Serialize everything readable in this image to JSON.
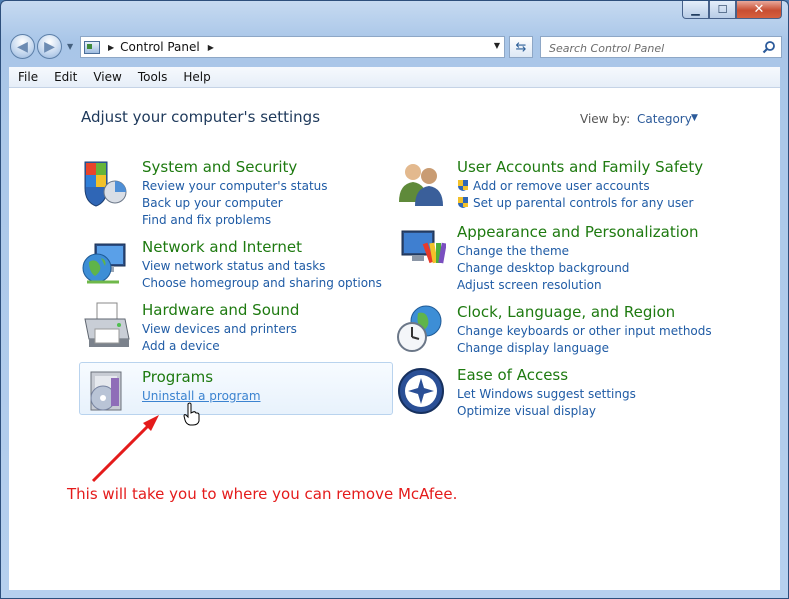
{
  "window": {
    "caption_buttons": {
      "minimize": "▁",
      "maximize": "☐",
      "close": "✕"
    }
  },
  "address_bar": {
    "path": "Control Panel",
    "search_placeholder": "Search Control Panel"
  },
  "menu": [
    "File",
    "Edit",
    "View",
    "Tools",
    "Help"
  ],
  "content": {
    "heading": "Adjust your computer's settings",
    "view_by_label": "View by:",
    "view_by_value": "Category",
    "categories_left": [
      {
        "title": "System and Security",
        "icon": "system-security-icon",
        "links": [
          "Review your computer's status",
          "Back up your computer",
          "Find and fix problems"
        ]
      },
      {
        "title": "Network and Internet",
        "icon": "network-globe-icon",
        "links": [
          "View network status and tasks",
          "Choose homegroup and sharing options"
        ]
      },
      {
        "title": "Hardware and Sound",
        "icon": "printer-icon",
        "links": [
          "View devices and printers",
          "Add a device"
        ]
      },
      {
        "title": "Programs",
        "icon": "programs-icon",
        "links": [
          "Uninstall a program"
        ]
      }
    ],
    "categories_right": [
      {
        "title": "User Accounts and Family Safety",
        "icon": "users-icon",
        "links": [
          "Add or remove user accounts",
          "Set up parental controls for any user"
        ]
      },
      {
        "title": "Appearance and Personalization",
        "icon": "monitor-palette-icon",
        "links": [
          "Change the theme",
          "Change desktop background",
          "Adjust screen resolution"
        ]
      },
      {
        "title": "Clock, Language, and Region",
        "icon": "clock-globe-icon",
        "links": [
          "Change keyboards or other input methods",
          "Change display language"
        ]
      },
      {
        "title": "Ease of Access",
        "icon": "ease-of-access-icon",
        "links": [
          "Let Windows suggest settings",
          "Optimize visual display"
        ]
      }
    ]
  },
  "annotation": "This will take you to where you can remove McAfee.",
  "colors": {
    "title_green": "#1e7a10",
    "link_blue": "#1f5ba5",
    "annotation_red": "#e41b1b"
  }
}
